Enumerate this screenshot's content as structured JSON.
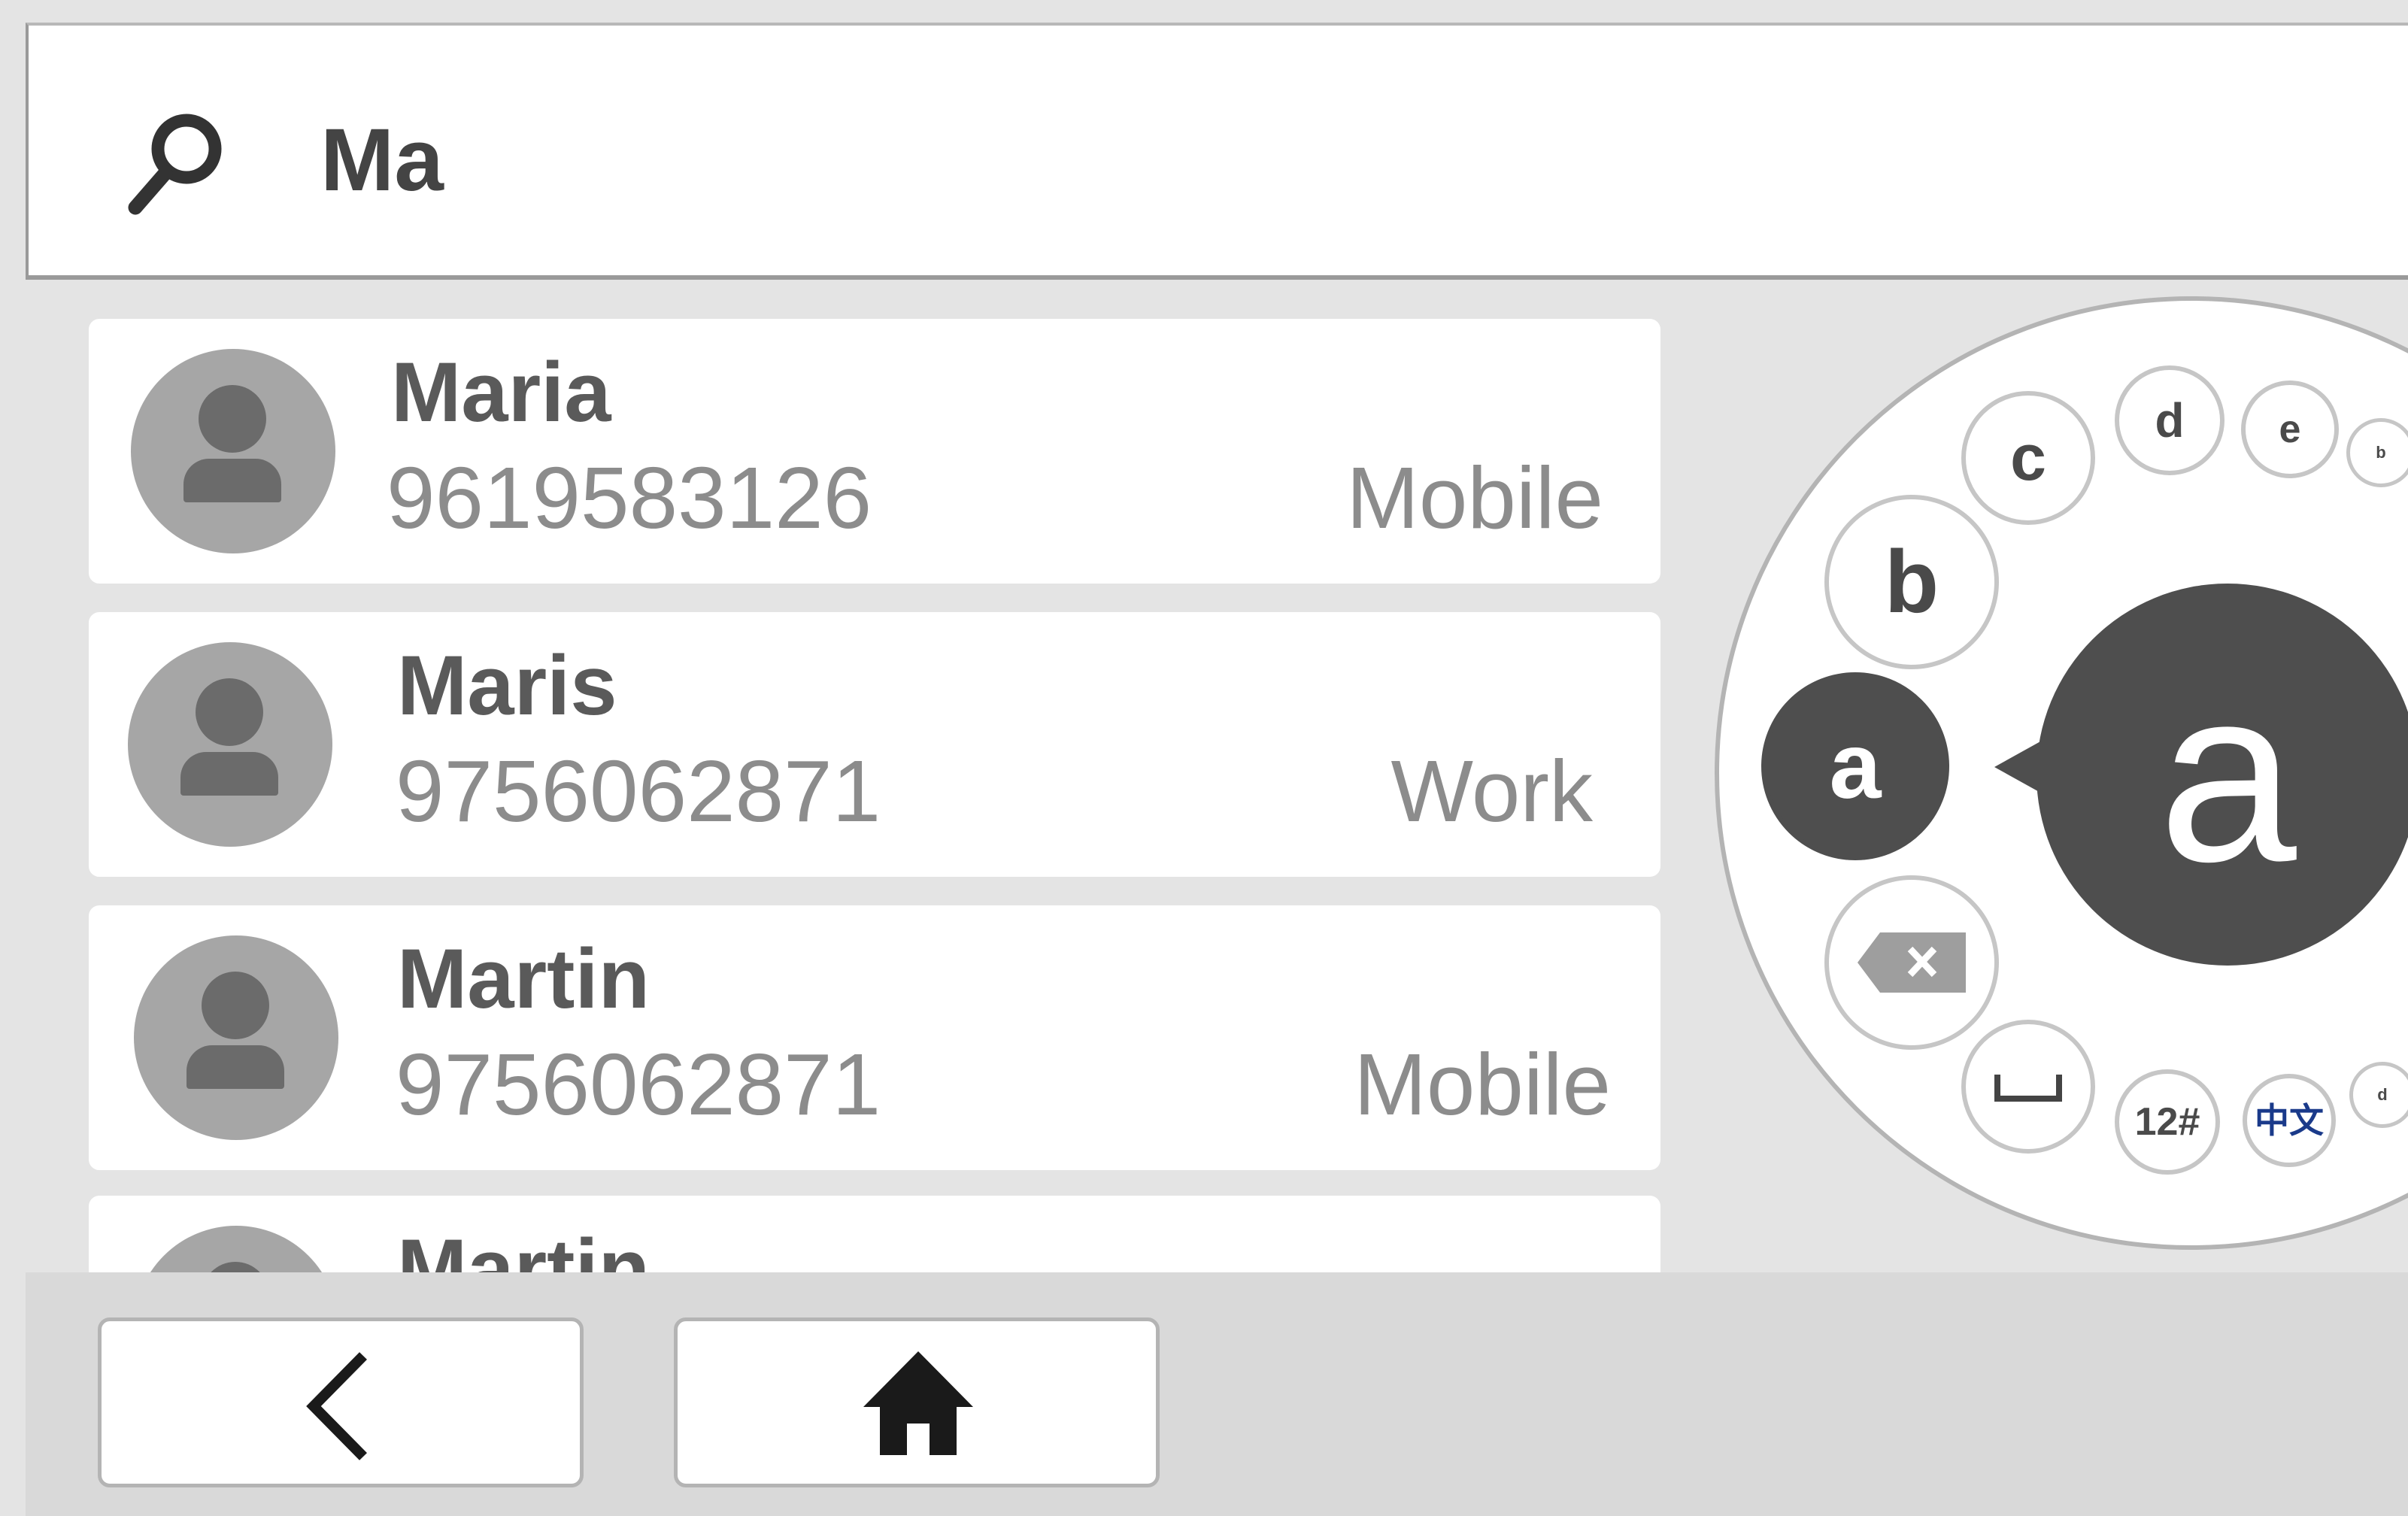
{
  "search": {
    "query": "Ma"
  },
  "contacts": [
    {
      "name": "Maria",
      "number": "9619583126",
      "type": "Mobile"
    },
    {
      "name": "Maris",
      "number": "9756062871",
      "type": "Work"
    },
    {
      "name": "Martin",
      "number": "9756062871",
      "type": "Mobile"
    },
    {
      "name": "Martin",
      "number": "",
      "type": ""
    }
  ],
  "dial": {
    "keys": {
      "a": "a",
      "b": "b",
      "c": "c",
      "d": "d",
      "e": "e",
      "small_b": "b",
      "small_d": "d",
      "numbers": "12#",
      "chinese": "中文"
    },
    "selected_letter": "a",
    "icons": [
      "backspace-icon",
      "space-icon"
    ]
  },
  "nav": {
    "icons": [
      "back-icon",
      "home-icon"
    ]
  },
  "colors": {
    "background": "#e4e4e4",
    "card": "#ffffff",
    "dark_key": "#4e4e4e",
    "chinese_key": "#1a3a8a"
  }
}
